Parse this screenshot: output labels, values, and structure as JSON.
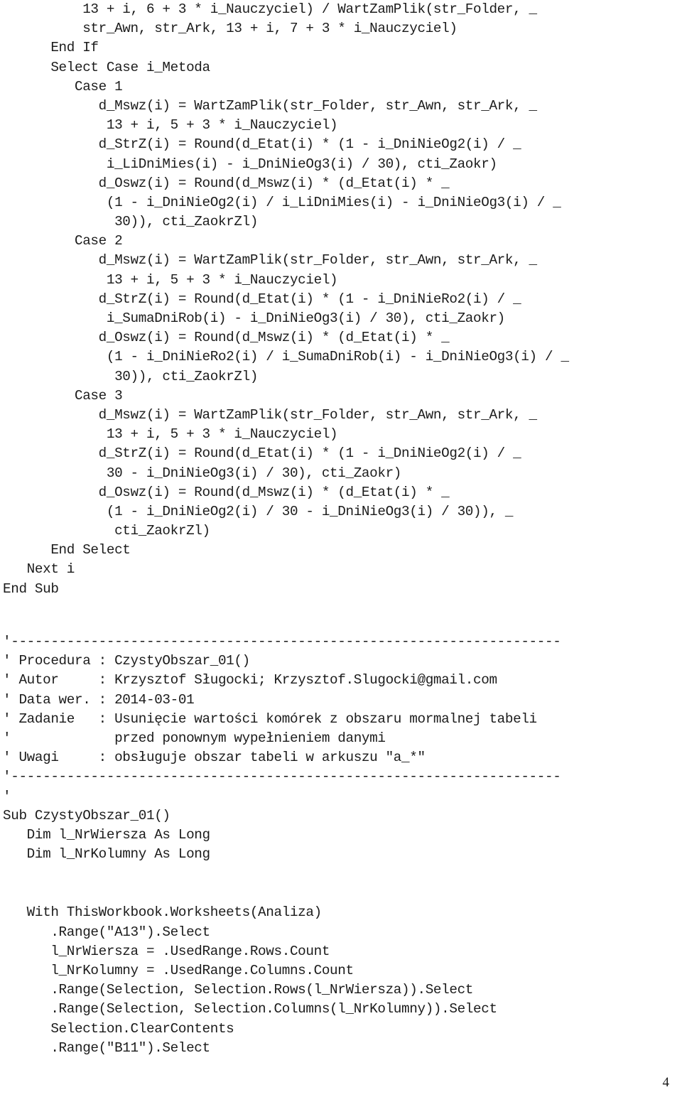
{
  "document": {
    "page_number": "4",
    "language": "VBA",
    "text_color": "#1b1b1b",
    "background_color": "#ffffff"
  },
  "code": {
    "block_1": [
      "          13 + i, 6 + 3 * i_Nauczyciel) / WartZamPlik(str_Folder, _",
      "          str_Awn, str_Ark, 13 + i, 7 + 3 * i_Nauczyciel)",
      "      End If",
      "      Select Case i_Metoda",
      "         Case 1",
      "            d_Mswz(i) = WartZamPlik(str_Folder, str_Awn, str_Ark, _",
      "             13 + i, 5 + 3 * i_Nauczyciel)",
      "            d_StrZ(i) = Round(d_Etat(i) * (1 - i_DniNieOg2(i) / _",
      "             i_LiDniMies(i) - i_DniNieOg3(i) / 30), cti_Zaokr)",
      "            d_Oswz(i) = Round(d_Mswz(i) * (d_Etat(i) * _",
      "             (1 - i_DniNieOg2(i) / i_LiDniMies(i) - i_DniNieOg3(i) / _",
      "              30)), cti_ZaokrZl)",
      "         Case 2",
      "            d_Mswz(i) = WartZamPlik(str_Folder, str_Awn, str_Ark, _",
      "             13 + i, 5 + 3 * i_Nauczyciel)",
      "            d_StrZ(i) = Round(d_Etat(i) * (1 - i_DniNieRo2(i) / _",
      "             i_SumaDniRob(i) - i_DniNieOg3(i) / 30), cti_Zaokr)",
      "            d_Oswz(i) = Round(d_Mswz(i) * (d_Etat(i) * _",
      "             (1 - i_DniNieRo2(i) / i_SumaDniRob(i) - i_DniNieOg3(i) / _",
      "              30)), cti_ZaokrZl)",
      "         Case 3",
      "            d_Mswz(i) = WartZamPlik(str_Folder, str_Awn, str_Ark, _",
      "             13 + i, 5 + 3 * i_Nauczyciel)",
      "            d_StrZ(i) = Round(d_Etat(i) * (1 - i_DniNieOg2(i) / _",
      "             30 - i_DniNieOg3(i) / 30), cti_Zaokr)",
      "            d_Oswz(i) = Round(d_Mswz(i) * (d_Etat(i) * _",
      "             (1 - i_DniNieOg2(i) / 30 - i_DniNieOg3(i) / 30)), _",
      "              cti_ZaokrZl)",
      "      End Select",
      "   Next i",
      "End Sub"
    ],
    "block_2": [
      "'---------------------------------------------------------------------",
      "' Procedura : CzystyObszar_01()",
      "' Autor     : Krzysztof Sługocki; Krzysztof.Slugocki@gmail.com",
      "' Data wer. : 2014-03-01",
      "' Zadanie   : Usunięcie wartości komórek z obszaru mormalnej tabeli",
      "'             przed ponownym wypełnieniem danymi",
      "' Uwagi     : obsługuje obszar tabeli w arkuszu \"a_*\"",
      "'---------------------------------------------------------------------",
      "'"
    ],
    "block_3": [
      "Sub CzystyObszar_01()",
      "   Dim l_NrWiersza As Long",
      "   Dim l_NrKolumny As Long"
    ],
    "block_4": [
      "   With ThisWorkbook.Worksheets(Analiza)",
      "      .Range(\"A13\").Select",
      "      l_NrWiersza = .UsedRange.Rows.Count",
      "      l_NrKolumny = .UsedRange.Columns.Count",
      "      .Range(Selection, Selection.Rows(l_NrWiersza)).Select",
      "      .Range(Selection, Selection.Columns(l_NrKolumny)).Select",
      "      Selection.ClearContents",
      "      .Range(\"B11\").Select"
    ]
  }
}
